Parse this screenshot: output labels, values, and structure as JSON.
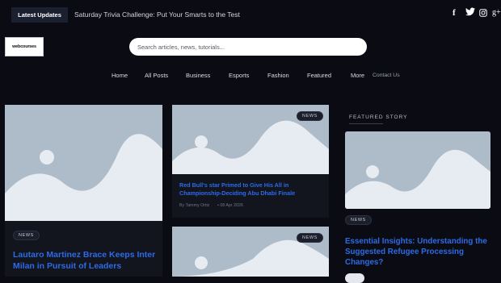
{
  "topbar": {
    "latest_label": "Latest Updates",
    "ticker_text": "Saturday Trivia Challenge: Put Your Smarts to the Test",
    "social": [
      {
        "icon": "facebook-icon",
        "glyph": "f"
      },
      {
        "icon": "twitter-icon",
        "glyph": "🐦"
      },
      {
        "icon": "instagram-icon",
        "glyph": "◎"
      },
      {
        "icon": "google-plus-icon",
        "glyph": "g+"
      }
    ]
  },
  "header": {
    "logo_text": "webcourses",
    "search_placeholder": "Search articles, news, tutorials..."
  },
  "nav": {
    "home": "Home",
    "all_posts": "All Posts",
    "business": "Business",
    "esports": "Esports",
    "fashion": "Fashion",
    "featured": "Featured",
    "more": "More",
    "contact": "Contact Us"
  },
  "cards": {
    "left": {
      "badge": "News",
      "title": "Lautaro Martinez Brace Keeps Inter Milan in Pursuit of Leaders"
    },
    "middle_top": {
      "badge": "News",
      "title": "Red Bull's star Primed to Give His All in Championship-Deciding Abu Dhabi Finale",
      "author": "By Tammy Ortiz",
      "date": "• 08 Apr 2026"
    },
    "middle_bottom": {
      "badge": "News"
    },
    "featured": {
      "label": "FEATURED STORY",
      "badge": "News",
      "title": "Essential Insights: Understanding the Suggested Refugee Processing Changes?"
    }
  },
  "colors": {
    "accent_blue": "#2d6be6",
    "background": "#0b0c13",
    "placeholder": "#aebbc8"
  }
}
